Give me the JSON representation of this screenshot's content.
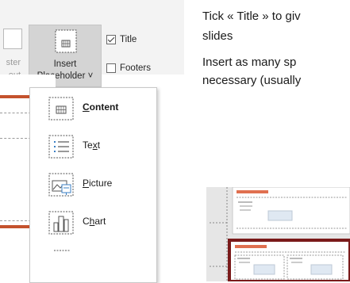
{
  "ribbon": {
    "master_layout_line1": "ster",
    "master_layout_line2": "out",
    "insert_placeholder_line1": "Insert",
    "insert_placeholder_line2": "Placeholder ˅",
    "title_checkbox": {
      "label": "Title",
      "checked": true
    },
    "footers_checkbox": {
      "label": "Footers",
      "checked": false
    }
  },
  "dropdown": {
    "items": [
      {
        "label": "Content",
        "underline": "C",
        "rest": "ontent",
        "icon": "content-placeholder-icon",
        "bold": true
      },
      {
        "label": "Text",
        "pre": "Te",
        "underline": "x",
        "post": "t",
        "icon": "text-placeholder-icon",
        "bold": false
      },
      {
        "label": "Picture",
        "underline": "P",
        "rest": "icture",
        "icon": "picture-placeholder-icon",
        "bold": false
      },
      {
        "label": "Chart",
        "pre": "C",
        "underline": "h",
        "post": "art",
        "icon": "chart-placeholder-icon",
        "bold": false
      }
    ]
  },
  "instructions": {
    "line1": "Tick « Title » to giv",
    "line2": "slides",
    "line3": "Insert as many sp",
    "line4": "necessary (usually"
  },
  "colors": {
    "accent_red": "#c4522d",
    "frame_dark_red": "#7a1a1a",
    "ribbon_bg": "#f3f3f3",
    "selected_button": "#d4d4d4"
  }
}
